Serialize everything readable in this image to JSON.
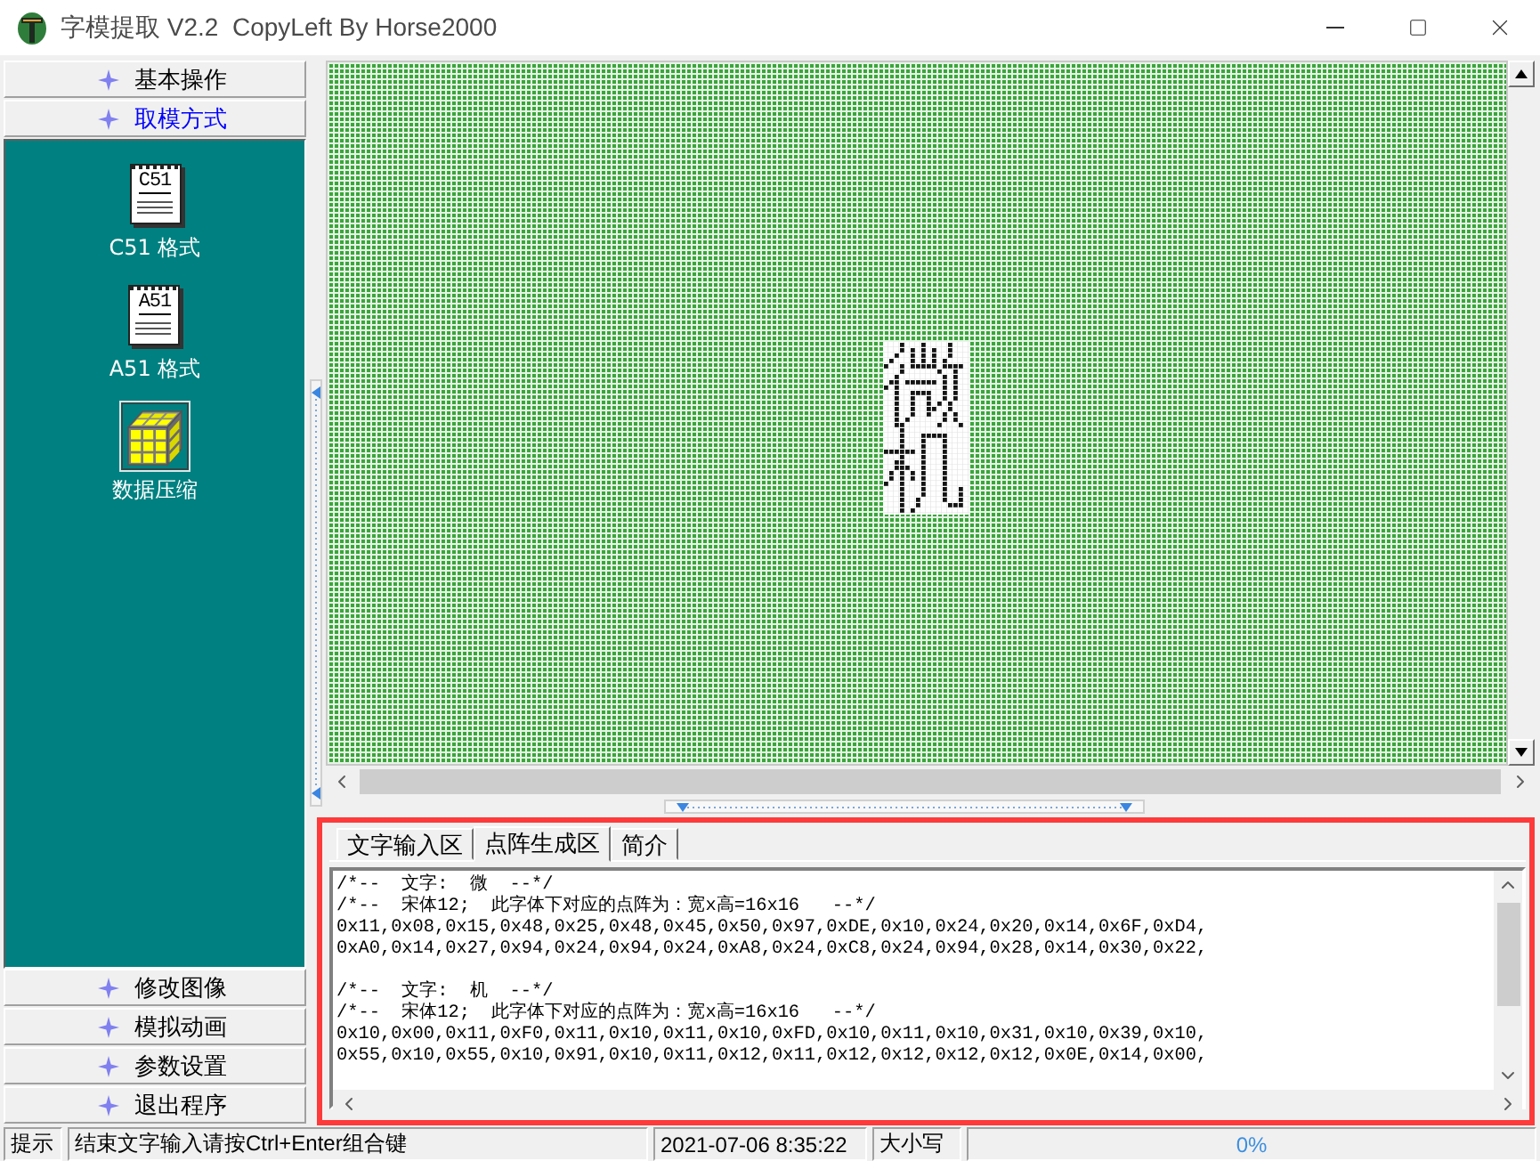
{
  "window": {
    "title": "字模提取 V2.2  CopyLeft By Horse2000"
  },
  "sidebar": {
    "groups": [
      {
        "label": "基本操作",
        "selected": false
      },
      {
        "label": "取模方式",
        "selected": true,
        "items": [
          {
            "kind": "document",
            "badge": "C51",
            "label": "C51 格式",
            "selected": false
          },
          {
            "kind": "document",
            "badge": "A51",
            "label": "A51 格式",
            "selected": false
          },
          {
            "kind": "cube",
            "label": "数据压缩",
            "selected": true
          }
        ]
      },
      {
        "label": "修改图像",
        "selected": false
      },
      {
        "label": "模拟动画",
        "selected": false
      },
      {
        "label": "参数设置",
        "selected": false
      },
      {
        "label": "退出程序",
        "selected": false
      }
    ]
  },
  "output_panel": {
    "highlighted": true,
    "tabs": [
      {
        "label": "文字输入区",
        "selected": false
      },
      {
        "label": "点阵生成区",
        "selected": true
      },
      {
        "label": "简介",
        "selected": false
      }
    ],
    "blocks": [
      {
        "comments": [
          "/*--  文字:  微  --*/",
          "/*--  宋体12;  此字体下对应的点阵为：宽x高=16x16   --*/"
        ],
        "data": [
          "0x11,0x08,0x15,0x48,0x25,0x48,0x45,0x50,0x97,0xDE,0x10,0x24,0x20,0x14,0x6F,0xD4,",
          "0xA0,0x14,0x27,0x94,0x24,0x94,0x24,0xA8,0x24,0xC8,0x24,0x94,0x28,0x14,0x30,0x22,"
        ]
      },
      {
        "comments": [
          "/*--  文字:  机  --*/",
          "/*--  宋体12;  此字体下对应的点阵为：宽x高=16x16   --*/"
        ],
        "data": [
          "0x10,0x00,0x11,0xF0,0x11,0x10,0x11,0x10,0xFD,0x10,0x11,0x10,0x31,0x10,0x39,0x10,",
          "0x55,0x10,0x55,0x10,0x91,0x10,0x11,0x12,0x11,0x12,0x12,0x12,0x12,0x0E,0x14,0x00,"
        ]
      }
    ]
  },
  "status_bar": {
    "hint": "提示",
    "message": "结束文字输入请按Ctrl+Enter组合键",
    "datetime": "2021-07-06 8:35:22",
    "caps": "大小写",
    "progress": "0%"
  }
}
